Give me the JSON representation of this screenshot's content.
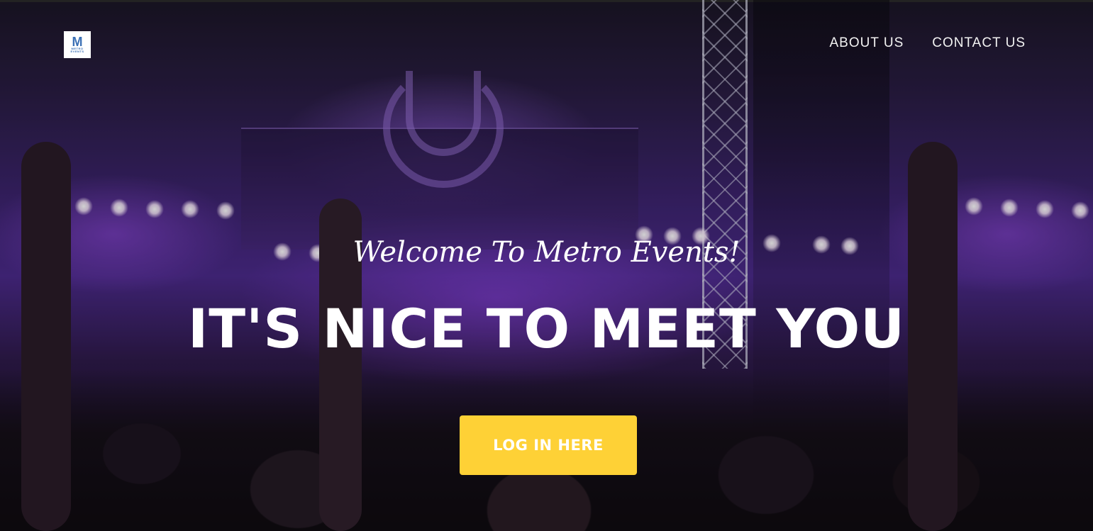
{
  "brand": {
    "logo_mark": "M",
    "logo_text_line1": "METRO",
    "logo_text_line2": "EVENTS"
  },
  "nav": {
    "items": [
      {
        "label": "ABOUT US"
      },
      {
        "label": "CONTACT US"
      }
    ]
  },
  "hero": {
    "subheading": "Welcome To Metro Events!",
    "heading": "IT'S NICE TO MEET YOU",
    "cta_label": "LOG IN HERE"
  },
  "colors": {
    "accent": "#fed136",
    "text": "#ffffff",
    "logo": "#3a6fb5"
  }
}
